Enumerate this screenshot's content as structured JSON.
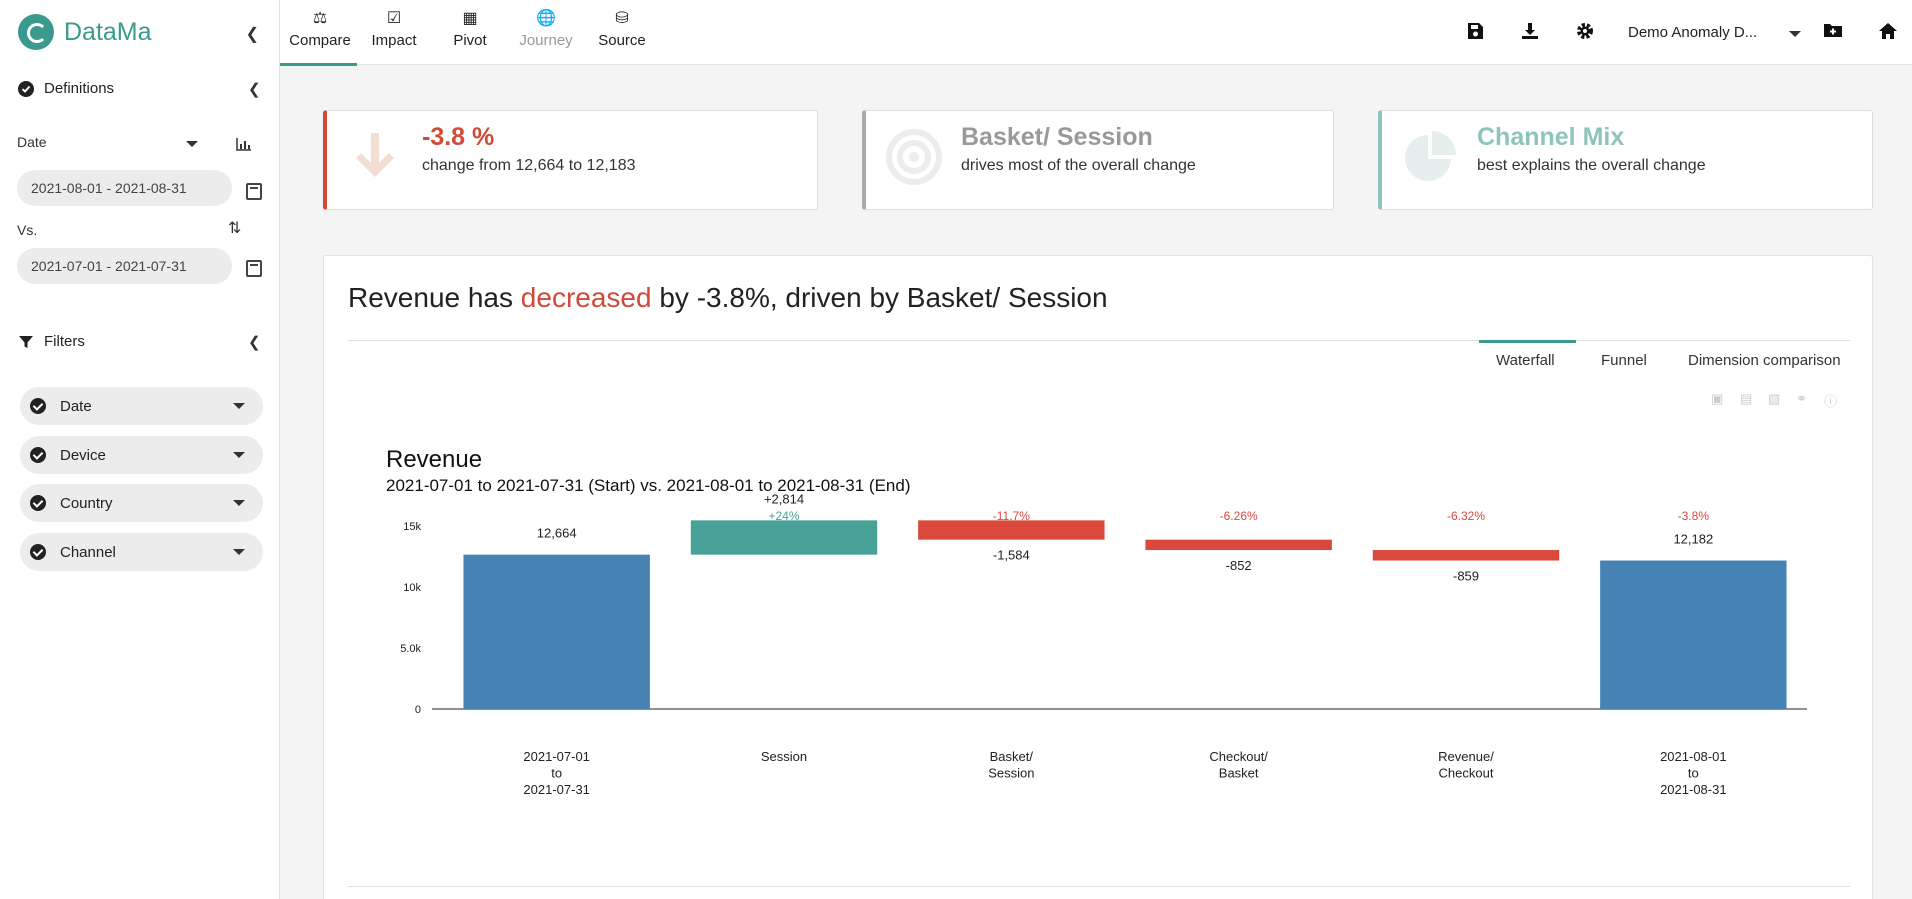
{
  "app": {
    "name": "DataMa"
  },
  "nav": {
    "tabs": [
      {
        "label": "Compare",
        "icon": "scale-icon"
      },
      {
        "label": "Impact",
        "icon": "check-square-icon"
      },
      {
        "label": "Pivot",
        "icon": "table-icon"
      },
      {
        "label": "Journey",
        "icon": "globe-icon"
      },
      {
        "label": "Source",
        "icon": "database-icon"
      }
    ],
    "active_tab": "Compare",
    "project": "Demo Anomaly D..."
  },
  "sidebar": {
    "definitions_title": "Definitions",
    "date_label": "Date",
    "date_value": "2021-08-01 - 2021-08-31",
    "vs_label": "Vs.",
    "vs_value": "2021-07-01 - 2021-07-31",
    "filters_title": "Filters",
    "filters": [
      "Date",
      "Device",
      "Country",
      "Channel"
    ]
  },
  "kpis": [
    {
      "value": "-3.8 %",
      "text": "change from 12,664 to 12,183",
      "color": "#d04a37"
    },
    {
      "value": "Basket/ Session",
      "text": "drives most of the overall change",
      "color": "#999999"
    },
    {
      "value": "Channel Mix",
      "text": "best explains the overall change",
      "color": "#8fc4bb"
    }
  ],
  "panel": {
    "headline_prefix": "Revenue has ",
    "headline_keyword": "decreased",
    "headline_suffix": " by -3.8%, driven by Basket/ Session",
    "chart_tabs": [
      "Waterfall",
      "Funnel",
      "Dimension comparison"
    ],
    "active_chart_tab": "Waterfall"
  },
  "chart_data": {
    "type": "bar",
    "subtype": "waterfall",
    "title": "Revenue",
    "subtitle": "2021-07-01 to 2021-07-31 (Start) vs. 2021-08-01 to 2021-08-31 (End)",
    "ylim": [
      0,
      16000
    ],
    "yticks": [
      {
        "value": 0,
        "label": "0"
      },
      {
        "value": 5000,
        "label": "5.0k"
      },
      {
        "value": 10000,
        "label": "10k"
      },
      {
        "value": 15000,
        "label": "15k"
      }
    ],
    "steps": [
      {
        "category": [
          "2021-07-01",
          "to",
          "2021-07-31"
        ],
        "kind": "total",
        "value": 12664,
        "label": "12,664",
        "pct": ""
      },
      {
        "category": [
          "Session"
        ],
        "kind": "delta",
        "value": 2814,
        "label": "+2,814",
        "pct": "+24%"
      },
      {
        "category": [
          "Basket/",
          "Session"
        ],
        "kind": "delta",
        "value": -1584,
        "label": "-1,584",
        "pct": "-11.7%"
      },
      {
        "category": [
          "Checkout/",
          "Basket"
        ],
        "kind": "delta",
        "value": -852,
        "label": "-852",
        "pct": "-6.26%"
      },
      {
        "category": [
          "Revenue/",
          "Checkout"
        ],
        "kind": "delta",
        "value": -859,
        "label": "-859",
        "pct": "-6.32%"
      },
      {
        "category": [
          "2021-08-01",
          "to",
          "2021-08-31"
        ],
        "kind": "total",
        "value": 12182,
        "label": "12,182",
        "pct": "-3.8%"
      }
    ],
    "colors": {
      "total": "#4682b4",
      "increase": "#48a196",
      "decrease": "#d9483b",
      "pct_positive": "#48a196",
      "pct_negative": "#d9483b"
    },
    "grid": false
  }
}
